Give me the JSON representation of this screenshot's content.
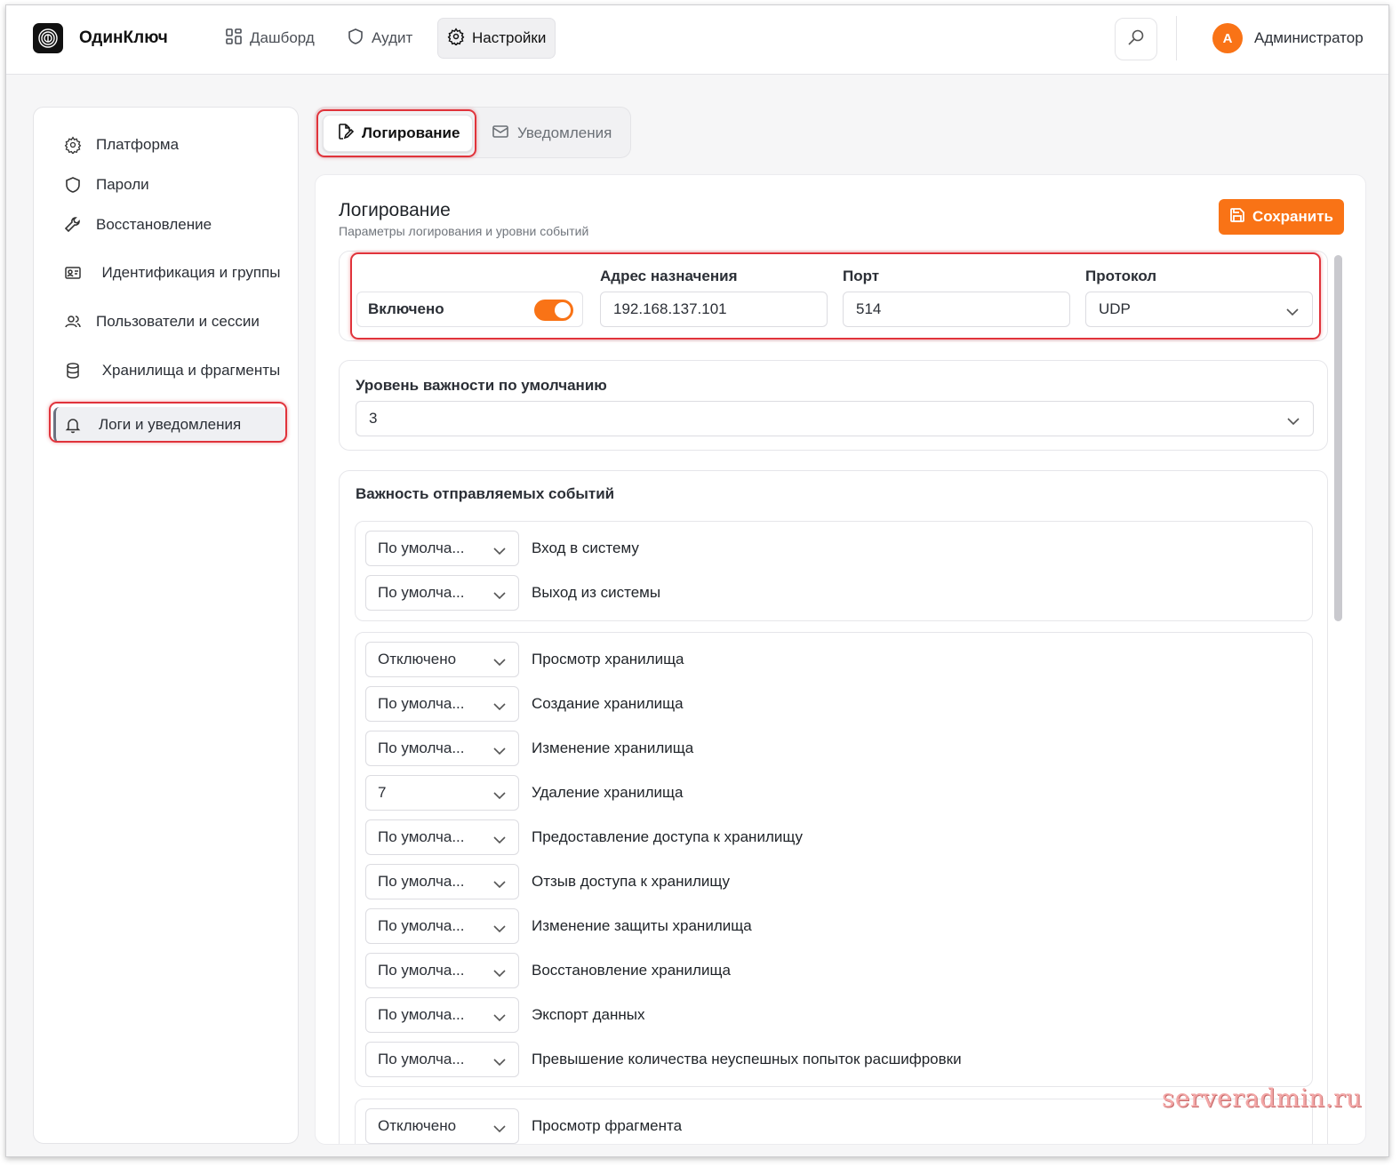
{
  "app": {
    "brand": "ОдинКлюч"
  },
  "nav": {
    "items": [
      {
        "label": "Дашборд",
        "icon": "grid-icon"
      },
      {
        "label": "Аудит",
        "icon": "shield-icon"
      },
      {
        "label": "Настройки",
        "icon": "gear-icon",
        "active": true
      }
    ]
  },
  "user": {
    "initial": "А",
    "name": "Администратор"
  },
  "sidebar": {
    "items": [
      {
        "label": "Платформа",
        "icon": "gear-icon"
      },
      {
        "label": "Пароли",
        "icon": "shield-icon"
      },
      {
        "label": "Восстановление",
        "icon": "wrench-icon"
      },
      {
        "label": "Идентификация и группы",
        "icon": "id-card-icon"
      },
      {
        "label": "Пользователи и сессии",
        "icon": "users-icon"
      },
      {
        "label": "Хранилища и фрагменты",
        "icon": "database-icon"
      },
      {
        "label": "Логи и уведомления",
        "icon": "bell-icon",
        "active": true
      }
    ]
  },
  "tabs": [
    {
      "label": "Логирование",
      "icon": "file-edit-icon",
      "active": true
    },
    {
      "label": "Уведомления",
      "icon": "mail-icon"
    }
  ],
  "logging": {
    "title": "Логирование",
    "subtitle": "Параметры логирования и уровни событий",
    "save_label": "Сохранить",
    "enabled_label": "Включено",
    "enabled": true,
    "address_label": "Адрес назначения",
    "address_value": "192.168.137.101",
    "port_label": "Порт",
    "port_value": "514",
    "protocol_label": "Протокол",
    "protocol_value": "UDP",
    "default_level_label": "Уровень важности по умолчанию",
    "default_level_value": "3",
    "events_title": "Важность отправляемых событий"
  },
  "event_groups": [
    [
      {
        "level": "По умолча...",
        "label": "Вход в систему"
      },
      {
        "level": "По умолча...",
        "label": "Выход из системы"
      }
    ],
    [
      {
        "level": "Отключено",
        "label": "Просмотр хранилища"
      },
      {
        "level": "По умолча...",
        "label": "Создание хранилища"
      },
      {
        "level": "По умолча...",
        "label": "Изменение хранилища"
      },
      {
        "level": "7",
        "label": "Удаление хранилища"
      },
      {
        "level": "По умолча...",
        "label": "Предоставление доступа к хранилищу"
      },
      {
        "level": "По умолча...",
        "label": "Отзыв доступа к хранилищу"
      },
      {
        "level": "По умолча...",
        "label": "Изменение защиты хранилища"
      },
      {
        "level": "По умолча...",
        "label": "Восстановление хранилища"
      },
      {
        "level": "По умолча...",
        "label": "Экспорт данных"
      },
      {
        "level": "По умолча...",
        "label": "Превышение количества неуспешных попыток расшифровки"
      }
    ],
    [
      {
        "level": "Отключено",
        "label": "Просмотр фрагмента"
      }
    ]
  ],
  "watermark": "serveradmin.ru",
  "colors": {
    "accent": "#f97316",
    "highlight": "#e0333b"
  }
}
